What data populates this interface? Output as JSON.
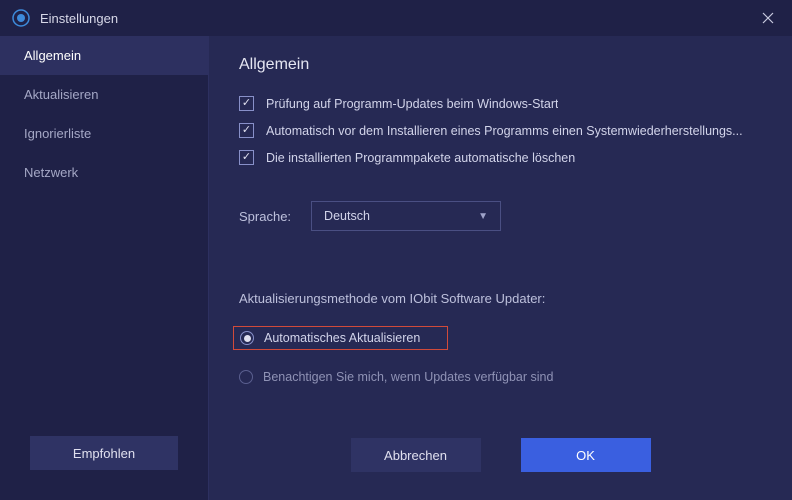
{
  "titlebar": {
    "title": "Einstellungen"
  },
  "sidebar": {
    "items": [
      {
        "label": "Allgemein",
        "active": true
      },
      {
        "label": "Aktualisieren",
        "active": false
      },
      {
        "label": "Ignorierliste",
        "active": false
      },
      {
        "label": "Netzwerk",
        "active": false
      }
    ],
    "recommend": "Empfohlen"
  },
  "content": {
    "heading": "Allgemein",
    "checks": [
      {
        "label": "Prüfung auf Programm-Updates beim Windows-Start",
        "checked": true
      },
      {
        "label": "Automatisch vor dem Installieren eines Programms einen Systemwiederherstellungs...",
        "checked": true
      },
      {
        "label": "Die installierten Programmpakete automatische löschen",
        "checked": true
      }
    ],
    "language": {
      "label": "Sprache:",
      "value": "Deutsch"
    },
    "updateMethod": {
      "label": "Aktualisierungsmethode vom IObit Software Updater:",
      "options": [
        {
          "label": "Automatisches Aktualisieren",
          "selected": true,
          "highlighted": true
        },
        {
          "label": "Benachtigen Sie mich, wenn Updates verfügbar sind",
          "selected": false,
          "highlighted": false
        }
      ]
    },
    "buttons": {
      "cancel": "Abbrechen",
      "ok": "OK"
    }
  }
}
